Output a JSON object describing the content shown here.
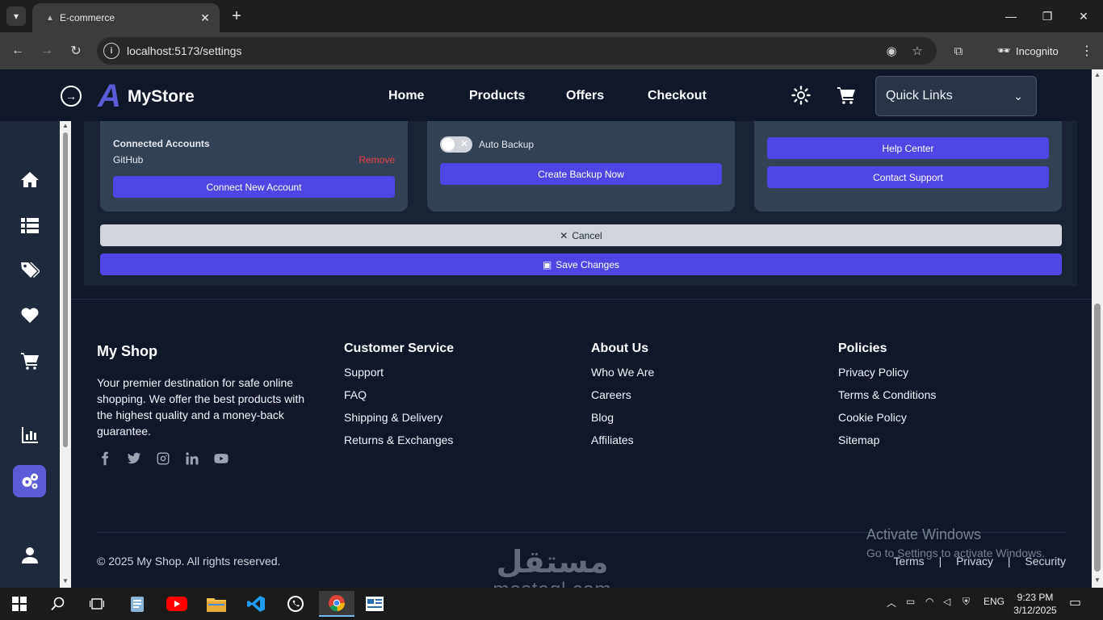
{
  "browser": {
    "tab_title": "E-commerce",
    "url": "localhost:5173/settings",
    "incognito_label": "Incognito"
  },
  "header": {
    "brand_mark": "A",
    "brand_name": "MyStore",
    "nav": [
      "Home",
      "Products",
      "Offers",
      "Checkout"
    ],
    "quick_links": "Quick Links"
  },
  "sidebar": {
    "icons": [
      "home-icon",
      "list-icon",
      "tags-icon",
      "heart-icon",
      "cart-icon",
      "chart-icon",
      "settings-icon",
      "user-icon"
    ],
    "active": "settings-icon"
  },
  "settings": {
    "connected_accounts_label": "Connected Accounts",
    "account_name": "GitHub",
    "remove_label": "Remove",
    "connect_button": "Connect New Account",
    "auto_backup_label": "Auto Backup",
    "auto_backup_enabled": false,
    "backup_button": "Create Backup Now",
    "help_center_button": "Help Center",
    "contact_support_button": "Contact Support",
    "cancel_button": "Cancel",
    "save_button": "Save Changes"
  },
  "footer": {
    "brand": "My Shop",
    "description": "Your premier destination for safe online shopping. We offer the best products with the highest quality and a money-back guarantee.",
    "socials": [
      "facebook-icon",
      "twitter-icon",
      "instagram-icon",
      "linkedin-icon",
      "youtube-icon"
    ],
    "columns": [
      {
        "title": "Customer Service",
        "links": [
          "Support",
          "FAQ",
          "Shipping & Delivery",
          "Returns & Exchanges"
        ]
      },
      {
        "title": "About Us",
        "links": [
          "Who We Are",
          "Careers",
          "Blog",
          "Affiliates"
        ]
      },
      {
        "title": "Policies",
        "links": [
          "Privacy Policy",
          "Terms & Conditions",
          "Cookie Policy",
          "Sitemap"
        ]
      }
    ],
    "copyright": "© 2025 My Shop. All rights reserved.",
    "legal": [
      "Terms",
      "Privacy",
      "Security"
    ],
    "legal_separator": "|"
  },
  "overlay": {
    "activate_title": "Activate Windows",
    "activate_sub": "Go to Settings to activate Windows.",
    "watermark_ar": "مستقل",
    "watermark_en": "mostaql.com"
  },
  "taskbar": {
    "time": "9:23 PM",
    "date": "3/12/2025",
    "lang": "ENG"
  },
  "colors": {
    "accent": "#4f46e5",
    "danger": "#ef4444",
    "page_bg": "#0f1729",
    "card_bg": "#334155"
  }
}
